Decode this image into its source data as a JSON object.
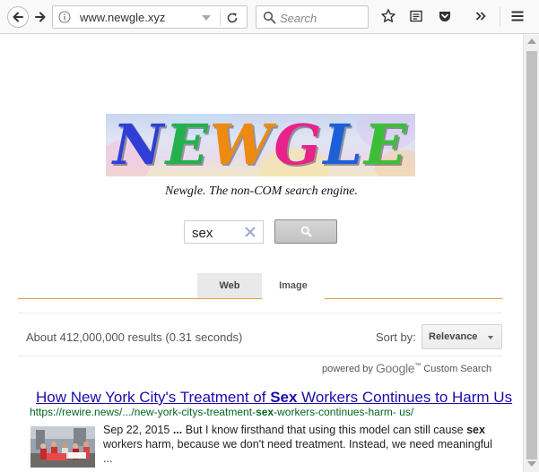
{
  "browser": {
    "url": "www.newgle.xyz",
    "search_placeholder": "Search"
  },
  "logo": {
    "text": "NEWGLE",
    "letters": [
      {
        "ch": "N",
        "color": "#2f3fd6"
      },
      {
        "ch": "E",
        "color": "#23b14d"
      },
      {
        "ch": "W",
        "color": "#ee8a12"
      },
      {
        "ch": "G",
        "color": "#e8228b"
      },
      {
        "ch": "L",
        "color": "#1d5fd8"
      },
      {
        "ch": "E",
        "color": "#3cbf38"
      }
    ]
  },
  "tagline": "Newgle. The non-COM search engine.",
  "search": {
    "query": "sex"
  },
  "tabs": [
    {
      "label": "Web",
      "active": true
    },
    {
      "label": "Image",
      "active": false
    }
  ],
  "results_info": {
    "count": "About 412,000,000 results (0.31 seconds)",
    "sort_label": "Sort by:",
    "sort_value": "Relevance"
  },
  "powered_by": {
    "prefix": "powered by",
    "brand": "Google",
    "suffix": "Custom Search"
  },
  "result": {
    "title_before": "How New York City's Treatment of ",
    "title_bold": "Sex",
    "title_after": " Workers Continues to Harm Us",
    "url_before": "https://rewire.news/.../new-york-citys-treatment-",
    "url_bold": "sex",
    "url_after": "-workers-continues-harm- us/",
    "date": "Sep 22, 2015",
    "snippet_sep": " ... ",
    "snippet_1": "But I know firsthand that using this model can still cause ",
    "snippet_bold": "sex",
    "snippet_2": " workers harm, because we don't need treatment. Instead, we need meaningful ..."
  },
  "colors": {
    "link": "#1a0dab",
    "url_green": "#006621",
    "tab_underline": "#dd9b3c"
  }
}
